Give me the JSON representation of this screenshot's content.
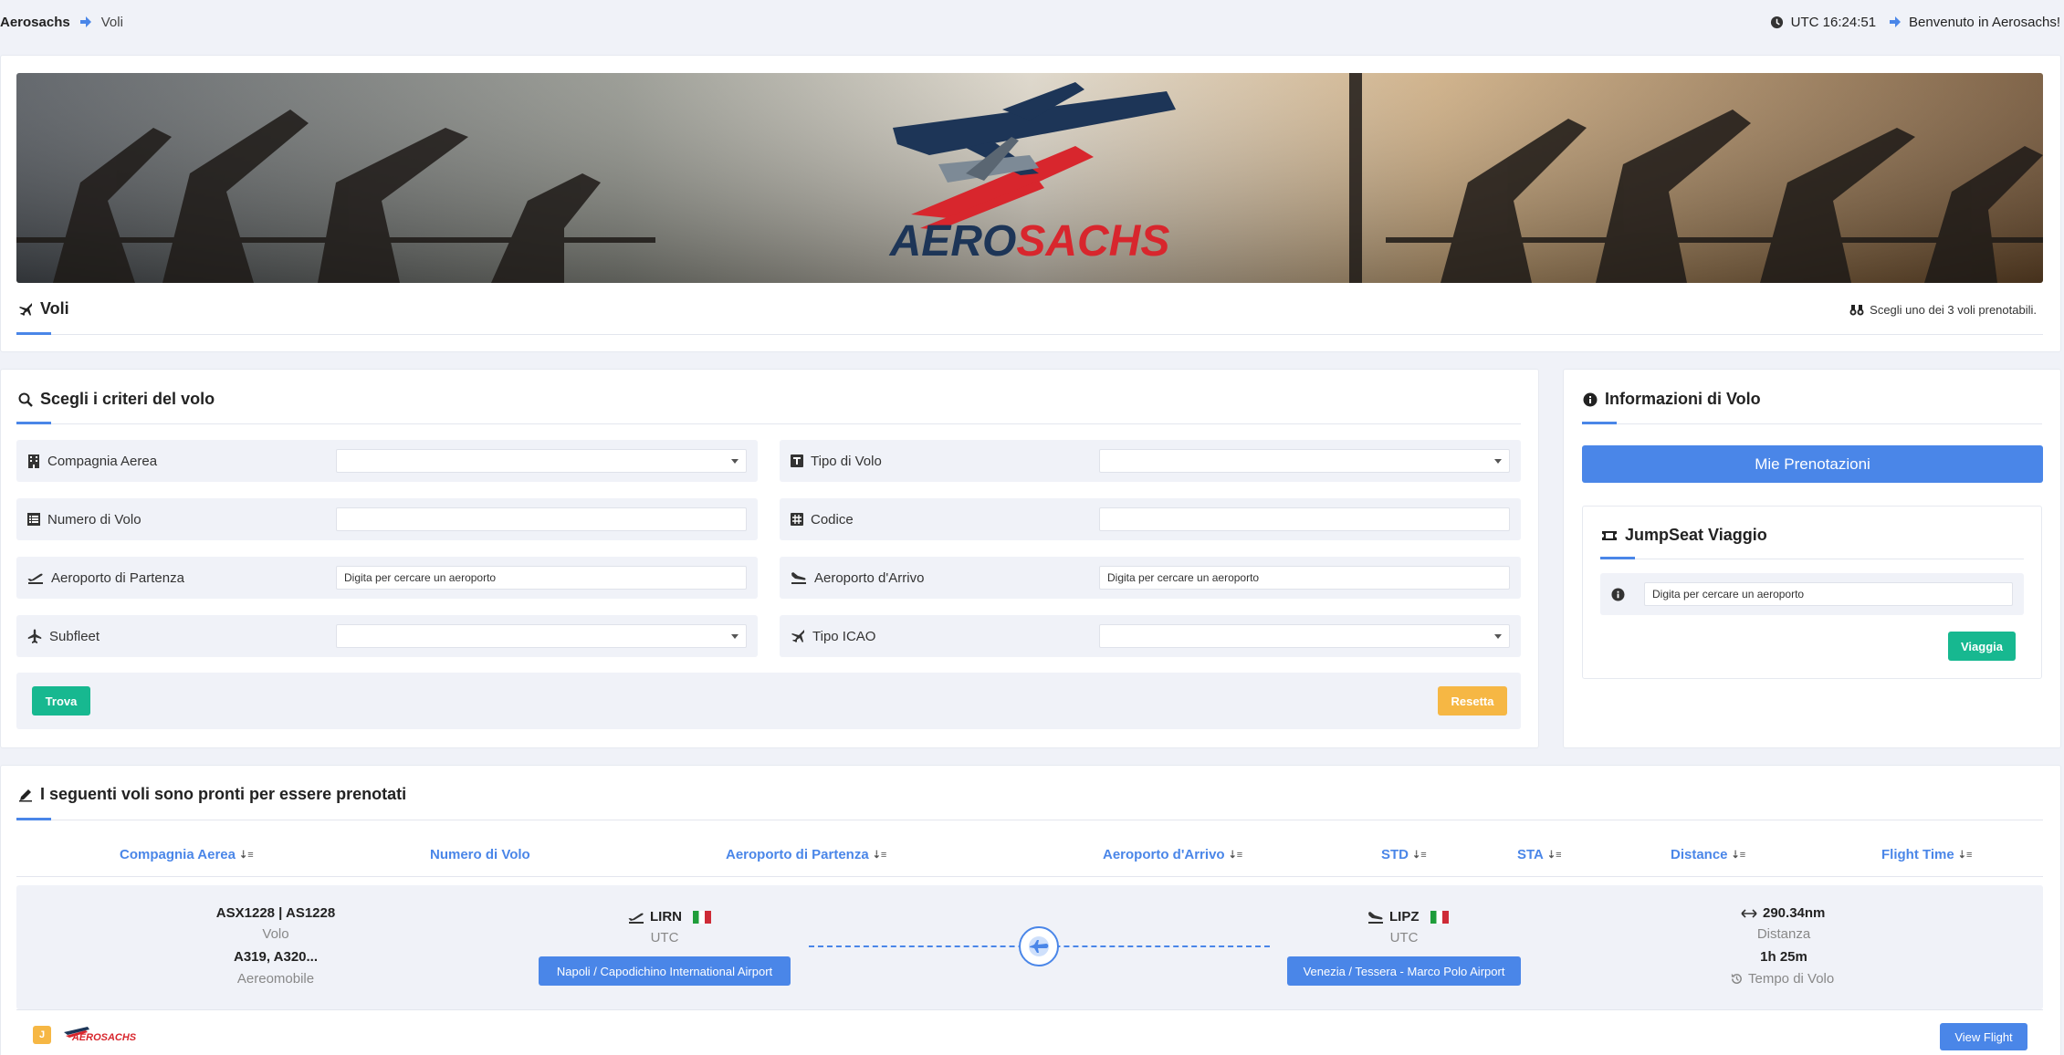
{
  "topbar": {
    "brand": "Aerosachs",
    "page": "Voli",
    "clock": "UTC 16:24:51",
    "welcome": "Benvenuto in Aerosachs!"
  },
  "banner": {
    "logo_text_1": "AERO",
    "logo_text_2": "SACHS"
  },
  "voli_header": {
    "title": "Voli",
    "info": "Scegli uno dei 3 voli prenotabili."
  },
  "criteria": {
    "title": "Scegli i criteri del volo",
    "fields": {
      "airline": {
        "label": "Compagnia Aerea",
        "value": ""
      },
      "flight_type": {
        "label": "Tipo di Volo",
        "value": ""
      },
      "flight_number": {
        "label": "Numero di Volo",
        "value": ""
      },
      "code": {
        "label": "Codice",
        "value": ""
      },
      "dep_airport": {
        "label": "Aeroporto di Partenza",
        "placeholder": "Digita per cercare un aeroporto"
      },
      "arr_airport": {
        "label": "Aeroporto d'Arrivo",
        "placeholder": "Digita per cercare un aeroporto"
      },
      "subfleet": {
        "label": "Subfleet",
        "value": ""
      },
      "icao_type": {
        "label": "Tipo ICAO",
        "value": ""
      }
    },
    "find_button": "Trova",
    "reset_button": "Resetta"
  },
  "flight_info": {
    "title": "Informazioni di Volo",
    "bookings_button": "Mie Prenotazioni",
    "jumpseat": {
      "title": "JumpSeat Viaggio",
      "placeholder": "Digita per cercare un aeroporto",
      "travel_button": "Viaggia"
    }
  },
  "results": {
    "title": "I seguenti voli sono pronti per essere prenotati",
    "columns": {
      "airline": "Compagnia Aerea",
      "flight_number": "Numero di Volo",
      "departure": "Aeroporto di Partenza",
      "arrival": "Aeroporto d'Arrivo",
      "std": "STD",
      "sta": "STA",
      "distance": "Distance",
      "flight_time": "Flight Time"
    },
    "flight": {
      "ident": "ASX1228 | AS1228",
      "ident_label": "Volo",
      "aircraft": "A319, A320...",
      "aircraft_label": "Aereomobile",
      "dep_icao": "LIRN",
      "dep_tz": "UTC",
      "dep_name": "Napoli / Capodichino International Airport",
      "arr_icao": "LIPZ",
      "arr_tz": "UTC",
      "arr_name": "Venezia / Tessera - Marco Polo Airport",
      "distance": "290.34nm",
      "distance_label": "Distanza",
      "time": "1h 25m",
      "time_label": "Tempo di Volo",
      "badge": "J",
      "mini_logo": "AEROSACHS",
      "view_button": "View Flight"
    }
  },
  "colors": {
    "accent": "#4a86e8",
    "green": "#17b890",
    "orange": "#f6b744",
    "background": "#f0f2f8"
  }
}
